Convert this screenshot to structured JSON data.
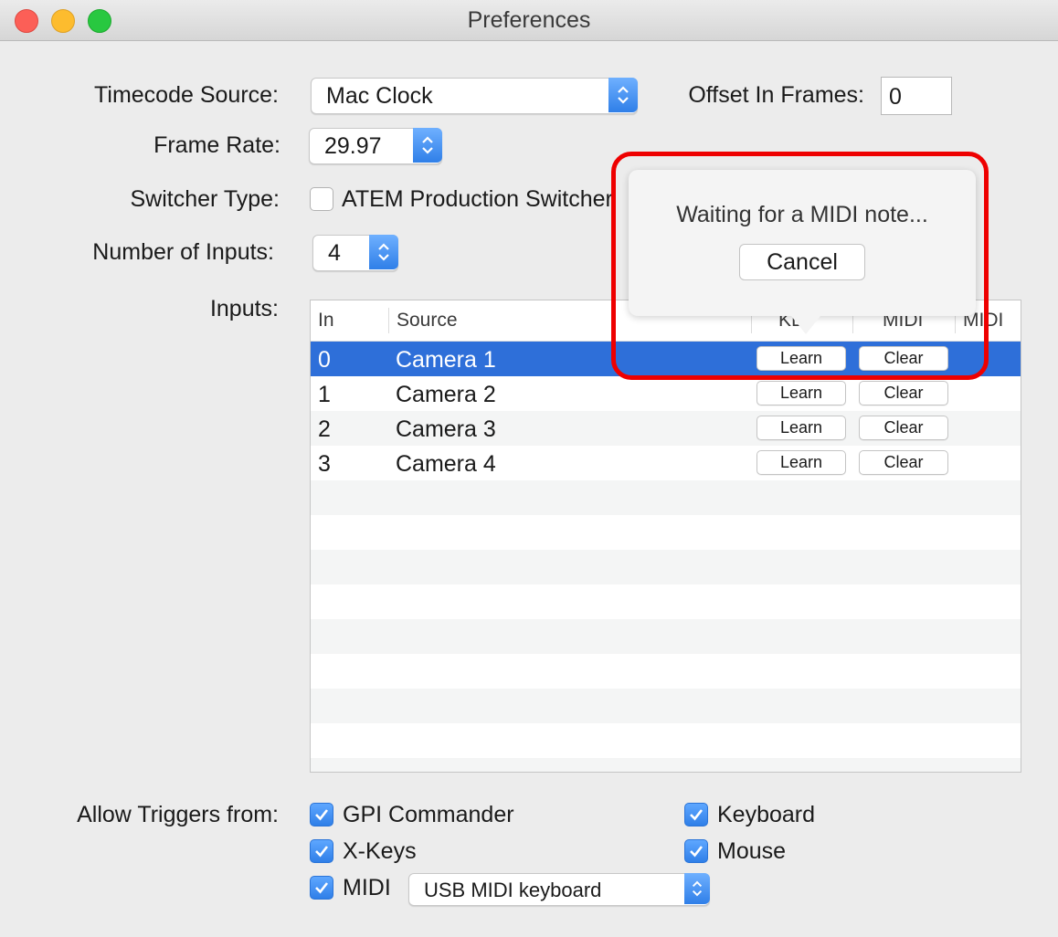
{
  "window": {
    "title": "Preferences"
  },
  "form": {
    "timecode_source_label": "Timecode Source:",
    "timecode_source_value": "Mac Clock",
    "offset_label": "Offset In Frames:",
    "offset_value": "0",
    "frame_rate_label": "Frame Rate:",
    "frame_rate_value": "29.97",
    "switcher_type_label": "Switcher Type:",
    "switcher_option": "ATEM Production Switcher",
    "number_inputs_label": "Number of Inputs:",
    "number_inputs_value": "4",
    "inputs_label": "Inputs:"
  },
  "table": {
    "headers": {
      "in": "In",
      "source": "Source",
      "key": "KEY",
      "midi1": "MIDI",
      "midi2": "MIDI"
    },
    "rows": [
      {
        "in": "0",
        "source": "Camera 1",
        "learn": "Learn",
        "clear": "Clear",
        "selected": true
      },
      {
        "in": "1",
        "source": "Camera 2",
        "learn": "Learn",
        "clear": "Clear"
      },
      {
        "in": "2",
        "source": "Camera 3",
        "learn": "Learn",
        "clear": "Clear"
      },
      {
        "in": "3",
        "source": "Camera 4",
        "learn": "Learn",
        "clear": "Clear"
      }
    ]
  },
  "popover": {
    "message": "Waiting for a MIDI note...",
    "cancel": "Cancel"
  },
  "triggers": {
    "label": "Allow Triggers from:",
    "gpi": "GPI Commander",
    "xkeys": "X-Keys",
    "midi": "MIDI",
    "midi_device": "USB MIDI keyboard",
    "keyboard": "Keyboard",
    "mouse": "Mouse"
  },
  "colors": {
    "accent": "#2e6fd9",
    "highlight": "#ee0000"
  }
}
